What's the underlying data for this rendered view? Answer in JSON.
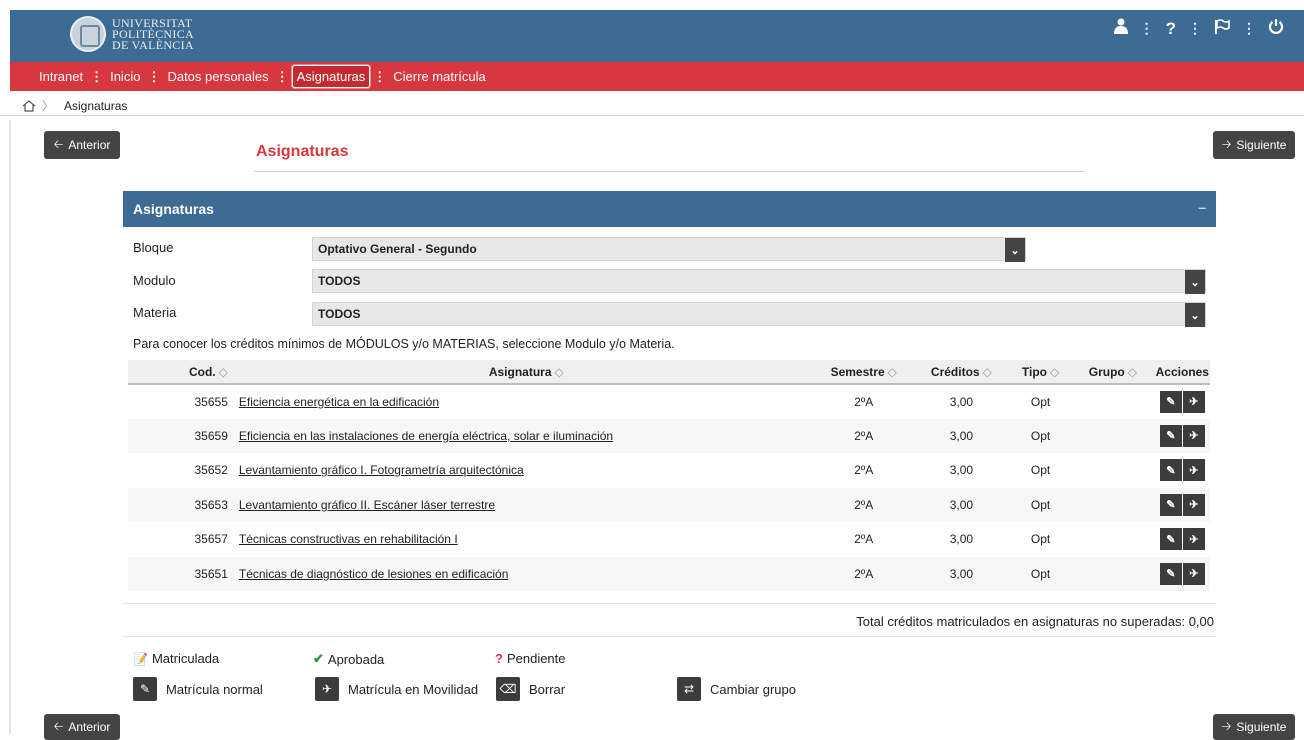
{
  "header": {
    "logo_lines": [
      "UNIVERSITAT",
      "POLITÈCNICA",
      "DE VALÈNCIA"
    ],
    "icons": [
      "user-icon",
      "help-icon",
      "flag-icon",
      "power-icon"
    ]
  },
  "nav": {
    "items": [
      {
        "label": "Intranet"
      },
      {
        "label": "Inicio"
      },
      {
        "label": "Datos personales"
      },
      {
        "label": "Asignaturas",
        "active": true
      },
      {
        "label": "Cierre matrícula"
      }
    ]
  },
  "breadcrumb": {
    "current": "Asignaturas"
  },
  "buttons": {
    "prev": "Anterior",
    "next": "Siguiente"
  },
  "page_title": "Asignaturas",
  "panel": {
    "title": "Asignaturas",
    "collapse": "–",
    "filters": {
      "bloque_label": "Bloque",
      "bloque_value": "Optativo General - Segundo",
      "modulo_label": "Modulo",
      "modulo_value": "TODOS",
      "materia_label": "Materia",
      "materia_value": "TODOS"
    },
    "note": "Para conocer los créditos mínimos de MÓDULOS y/o MATERIAS, seleccione Modulo y/o Materia."
  },
  "table": {
    "headers": {
      "cod": "Cod.",
      "asignatura": "Asignatura",
      "semestre": "Semestre",
      "creditos": "Créditos",
      "tipo": "Tipo",
      "grupo": "Grupo",
      "acciones": "Acciones"
    },
    "rows": [
      {
        "cod": "35655",
        "asignatura": "Eficiencia energética en la edificación",
        "semestre": "2ºA",
        "creditos": "3,00",
        "tipo": "Opt",
        "grupo": ""
      },
      {
        "cod": "35659",
        "asignatura": "Eficiencia en las instalaciones de energía eléctrica, solar e iluminación",
        "semestre": "2ºA",
        "creditos": "3,00",
        "tipo": "Opt",
        "grupo": ""
      },
      {
        "cod": "35652",
        "asignatura": "Levantamiento gráfico I. Fotogrametría arquitectónica",
        "semestre": "2ºA",
        "creditos": "3,00",
        "tipo": "Opt",
        "grupo": ""
      },
      {
        "cod": "35653",
        "asignatura": "Levantamiento gráfico II. Escáner láser terrestre",
        "semestre": "2ºA",
        "creditos": "3,00",
        "tipo": "Opt",
        "grupo": ""
      },
      {
        "cod": "35657",
        "asignatura": "Técnicas constructivas en rehabilitación I",
        "semestre": "2ºA",
        "creditos": "3,00",
        "tipo": "Opt",
        "grupo": ""
      },
      {
        "cod": "35651",
        "asignatura": "Técnicas de diagnóstico de lesiones en edificación",
        "semestre": "2ºA",
        "creditos": "3,00",
        "tipo": "Opt",
        "grupo": ""
      }
    ]
  },
  "total": "Total créditos matriculados en asignaturas no superadas: 0,00",
  "legend": {
    "matriculada": "Matriculada",
    "aprobada": "Aprobada",
    "pendiente": "Pendiente",
    "matricula_normal": "Matrícula normal",
    "matricula_movilidad": "Matrícula en Movilidad",
    "borrar": "Borrar",
    "cambiar_grupo": "Cambiar grupo"
  },
  "colors": {
    "header_blue": "#3d6b93",
    "nav_red": "#d7373f",
    "button_dark": "#444444",
    "approved_green": "#2e9e2e",
    "pending_red": "#d7373f"
  }
}
